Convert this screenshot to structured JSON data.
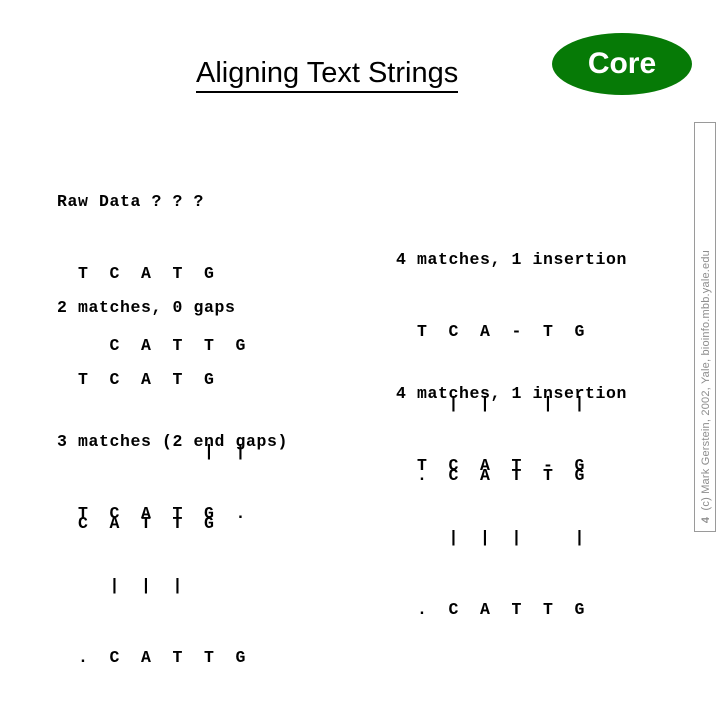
{
  "slide": {
    "title": "Aligning Text Strings",
    "badge_label": "Core",
    "badge_color": "#067a06",
    "badge_text_color": "#ffffff",
    "background": "#ffffff",
    "text_color": "#000000"
  },
  "blocks": {
    "raw": {
      "heading": "Raw Data ? ? ?",
      "line1": "  T  C  A  T  G",
      "line2": "     C  A  T  T  G"
    },
    "two_matches": {
      "heading": "2 matches, 0 gaps",
      "line1": "  T  C  A  T  G",
      "bars": "              |  |",
      "line2": "  C  A  T  T  G"
    },
    "three_matches": {
      "heading": "3 matches (2 end gaps)",
      "line1": "  T  C  A  T  G  .",
      "bars": "     |  |  |",
      "line2": "  .  C  A  T  T  G"
    },
    "insertion_a": {
      "heading": "4 matches, 1 insertion",
      "line1": "  T  C  A  -  T  G",
      "bars": "     |  |     |  |",
      "line2": "  .  C  A  T  T  G"
    },
    "insertion_b": {
      "heading": "4 matches, 1 insertion",
      "line1": "  T  C  A  T  -  G",
      "bars": "     |  |  |     |",
      "line2": "  .  C  A  T  T  G"
    }
  },
  "sidebar": {
    "credit": "(c) Mark Gerstein, 2002, Yale, bioinfo.mbb.yale.edu",
    "page_number": "4",
    "text_color": "#8d8d8d"
  }
}
